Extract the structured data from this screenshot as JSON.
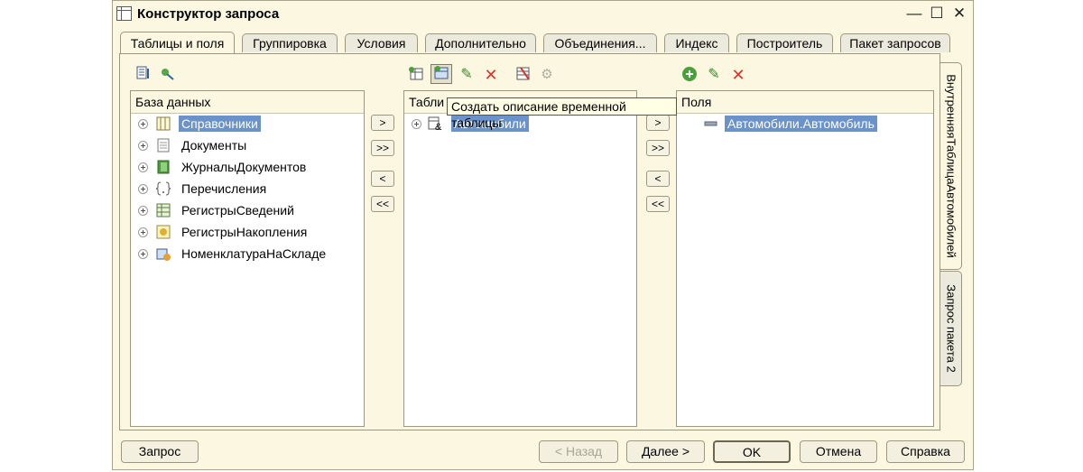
{
  "window": {
    "title": "Конструктор запроса",
    "minimize": "—",
    "maximize": "☐",
    "close": "✕"
  },
  "tabs": [
    {
      "label": "Таблицы и поля",
      "active": true
    },
    {
      "label": "Группировка"
    },
    {
      "label": "Условия"
    },
    {
      "label": "Дополнительно"
    },
    {
      "label": "Объединения..."
    },
    {
      "label": "Индекс"
    },
    {
      "label": "Построитель"
    },
    {
      "label": "Пакет запросов"
    }
  ],
  "side_tabs": [
    {
      "label": "ВнутренняяТаблицаАвтомобилей",
      "active": true
    },
    {
      "label": "Запрос пакета 2"
    }
  ],
  "database_panel": {
    "header": "База данных",
    "items": [
      {
        "label": "Справочники",
        "icon": "catalog-icon"
      },
      {
        "label": "Документы",
        "icon": "document-icon"
      },
      {
        "label": "ЖурналыДокументов",
        "icon": "journal-icon"
      },
      {
        "label": "Перечисления",
        "icon": "enum-icon"
      },
      {
        "label": "РегистрыСведений",
        "icon": "info-register-icon"
      },
      {
        "label": "РегистрыНакопления",
        "icon": "accumulation-register-icon"
      },
      {
        "label": "НоменклатураНаСкладе",
        "icon": "temp-table-icon"
      }
    ]
  },
  "tables_panel": {
    "header": "Табли",
    "items": [
      {
        "label": "Автомобили",
        "icon": "temp-table-icon"
      }
    ]
  },
  "fields_panel": {
    "header": "Поля",
    "items": [
      {
        "label": "Автомобили.Автомобиль",
        "icon": "field-icon"
      }
    ]
  },
  "tooltip": "Создать описание временной таблицы",
  "arrows": {
    "one": ">",
    "all": ">>",
    "back": "<",
    "back_all": "<<"
  },
  "footer": {
    "query": "Запрос",
    "back": "< Назад",
    "next": "Далее >",
    "ok": "OK",
    "cancel": "Отмена",
    "help": "Справка"
  },
  "colors": {
    "window_bg": "#fbf7e1",
    "selection": "#6b92c9",
    "delete_red": "#d8362b",
    "edit_green": "#3a8a2e"
  }
}
